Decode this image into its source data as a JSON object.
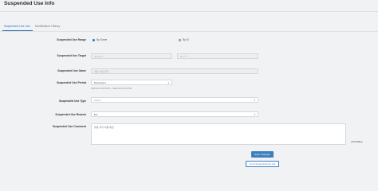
{
  "page": {
    "title": "Suspended Use Info"
  },
  "tabs": [
    {
      "label": "Suspended Use Info"
    },
    {
      "label": "Modification History"
    }
  ],
  "form": {
    "range": {
      "label": "Suspended Use Range",
      "options": [
        {
          "label": "By Game",
          "selected": true
        },
        {
          "label": "By ID",
          "selected": false
        }
      ]
    },
    "target": {
      "label": "Suspended Use Target",
      "game_value": "Game #",
      "id_value": "ID  ****"
    },
    "game_name": {
      "label": "Suspended Use Game",
      "value": "게임 이름 입력"
    },
    "period": {
      "label": "Suspended Use Period",
      "value": "Permanent",
      "helper": "0000-00-00 00:00:00 ~ 9999-12-31 23:59:59"
    },
    "type": {
      "label": "Suspended Use Type",
      "value": "Select"
    },
    "reason": {
      "label": "Suspended Use Reason",
      "value": "Etc"
    },
    "comment": {
      "label": "Suspended Use Comment",
      "value": "불량 유저 이용 제한",
      "counter": "(0/1000)Byte"
    }
  },
  "actions": {
    "save_label": "Save Changes",
    "back_label": "Go to Suspended Use List"
  },
  "colors": {
    "accent": "#3c7ec0",
    "background": "#f1f2f4"
  }
}
